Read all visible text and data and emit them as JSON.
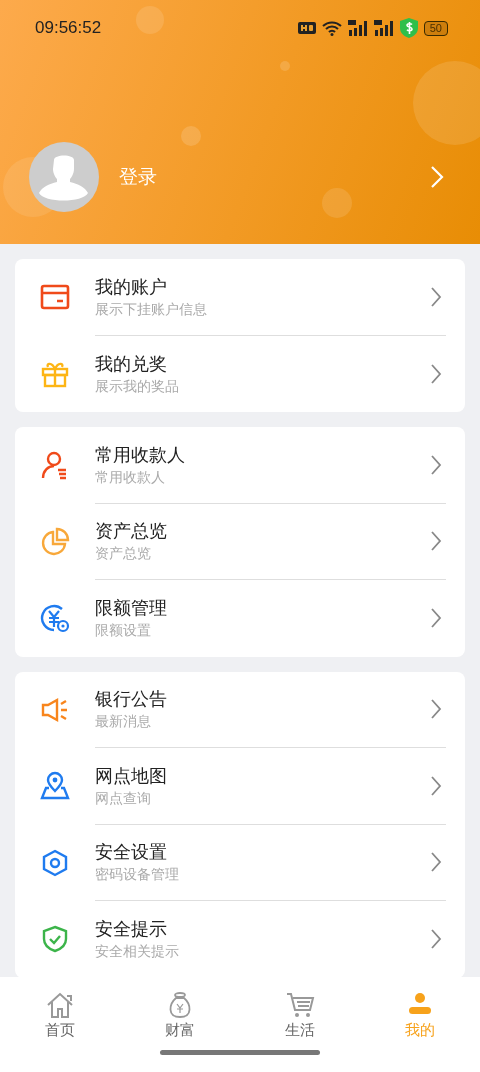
{
  "status_bar": {
    "time": "09:56:52",
    "battery": "50"
  },
  "profile": {
    "login_label": "登录"
  },
  "groups": [
    {
      "items": [
        {
          "title": "我的账户",
          "subtitle": "展示下挂账户信息"
        },
        {
          "title": "我的兑奖",
          "subtitle": "展示我的奖品"
        }
      ]
    },
    {
      "items": [
        {
          "title": "常用收款人",
          "subtitle": "常用收款人"
        },
        {
          "title": "资产总览",
          "subtitle": "资产总览"
        },
        {
          "title": "限额管理",
          "subtitle": "限额设置"
        }
      ]
    },
    {
      "items": [
        {
          "title": "银行公告",
          "subtitle": "最新消息"
        },
        {
          "title": "网点地图",
          "subtitle": "网点查询"
        },
        {
          "title": "安全设置",
          "subtitle": "密码设备管理"
        },
        {
          "title": "安全提示",
          "subtitle": "安全相关提示"
        }
      ]
    }
  ],
  "tabs": [
    {
      "label": "首页",
      "selected": false
    },
    {
      "label": "财富",
      "selected": false
    },
    {
      "label": "生活",
      "selected": false
    },
    {
      "label": "我的",
      "selected": true
    }
  ]
}
